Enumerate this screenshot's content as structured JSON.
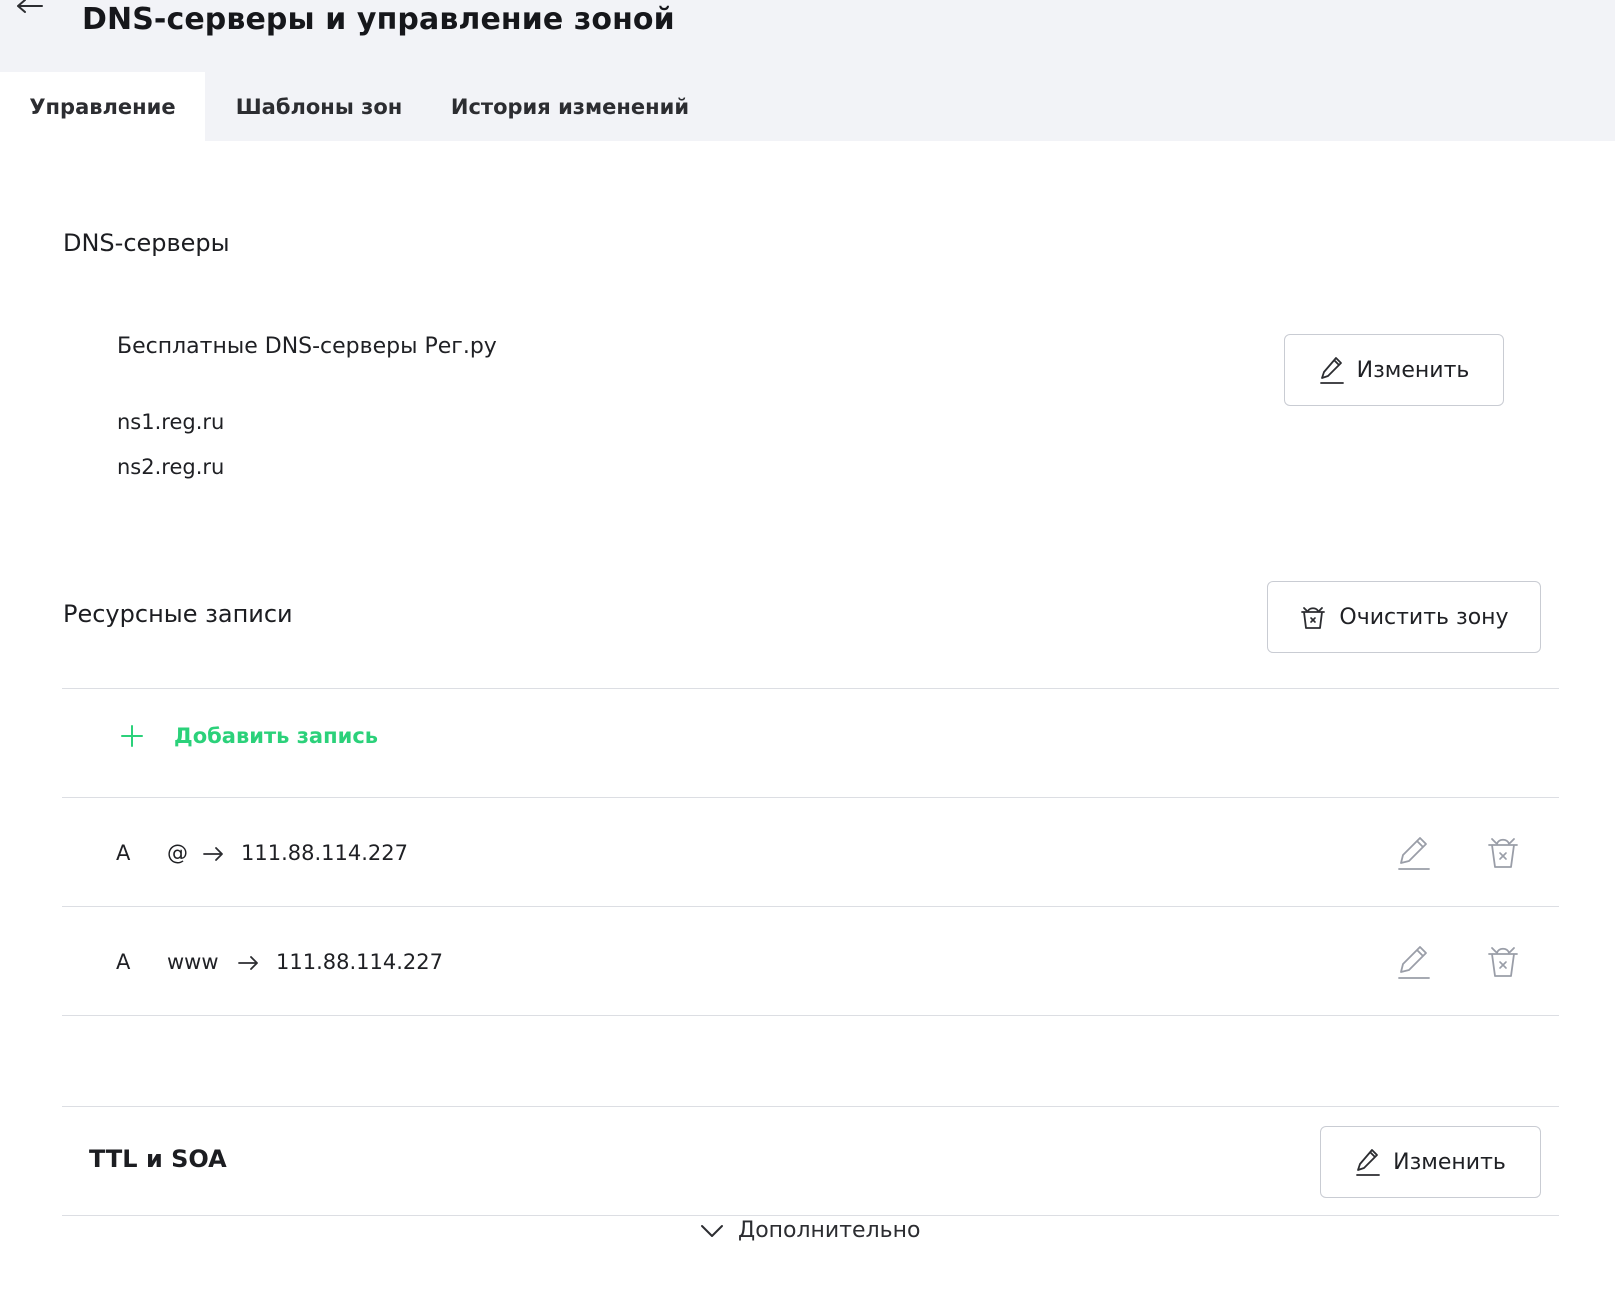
{
  "header": {
    "title": "DNS-серверы и управление зоной"
  },
  "tabs": [
    {
      "label": "Управление",
      "active": true
    },
    {
      "label": "Шаблоны зон",
      "active": false
    },
    {
      "label": "История изменений",
      "active": false
    }
  ],
  "dns_servers": {
    "title": "DNS-серверы",
    "provider": "Бесплатные DNS-серверы Рег.ру",
    "servers": [
      "ns1.reg.ru",
      "ns2.reg.ru"
    ],
    "edit_label": "Изменить"
  },
  "resource_records": {
    "title": "Ресурсные записи",
    "clear_label": "Очистить зону",
    "add_label": "Добавить запись",
    "records": [
      {
        "type": "A",
        "host": "@",
        "value": "111.88.114.227"
      },
      {
        "type": "A",
        "host": "www",
        "value": "111.88.114.227"
      }
    ]
  },
  "ttl_soa": {
    "title": "TTL и SOA",
    "edit_label": "Изменить",
    "more_label": "Дополнительно"
  },
  "colors": {
    "accent_green": "#2bd17a",
    "header_bg": "#f2f3f7",
    "text": "#1f2024",
    "muted_icon": "#9a9ea8",
    "border": "#c9ccd3"
  }
}
